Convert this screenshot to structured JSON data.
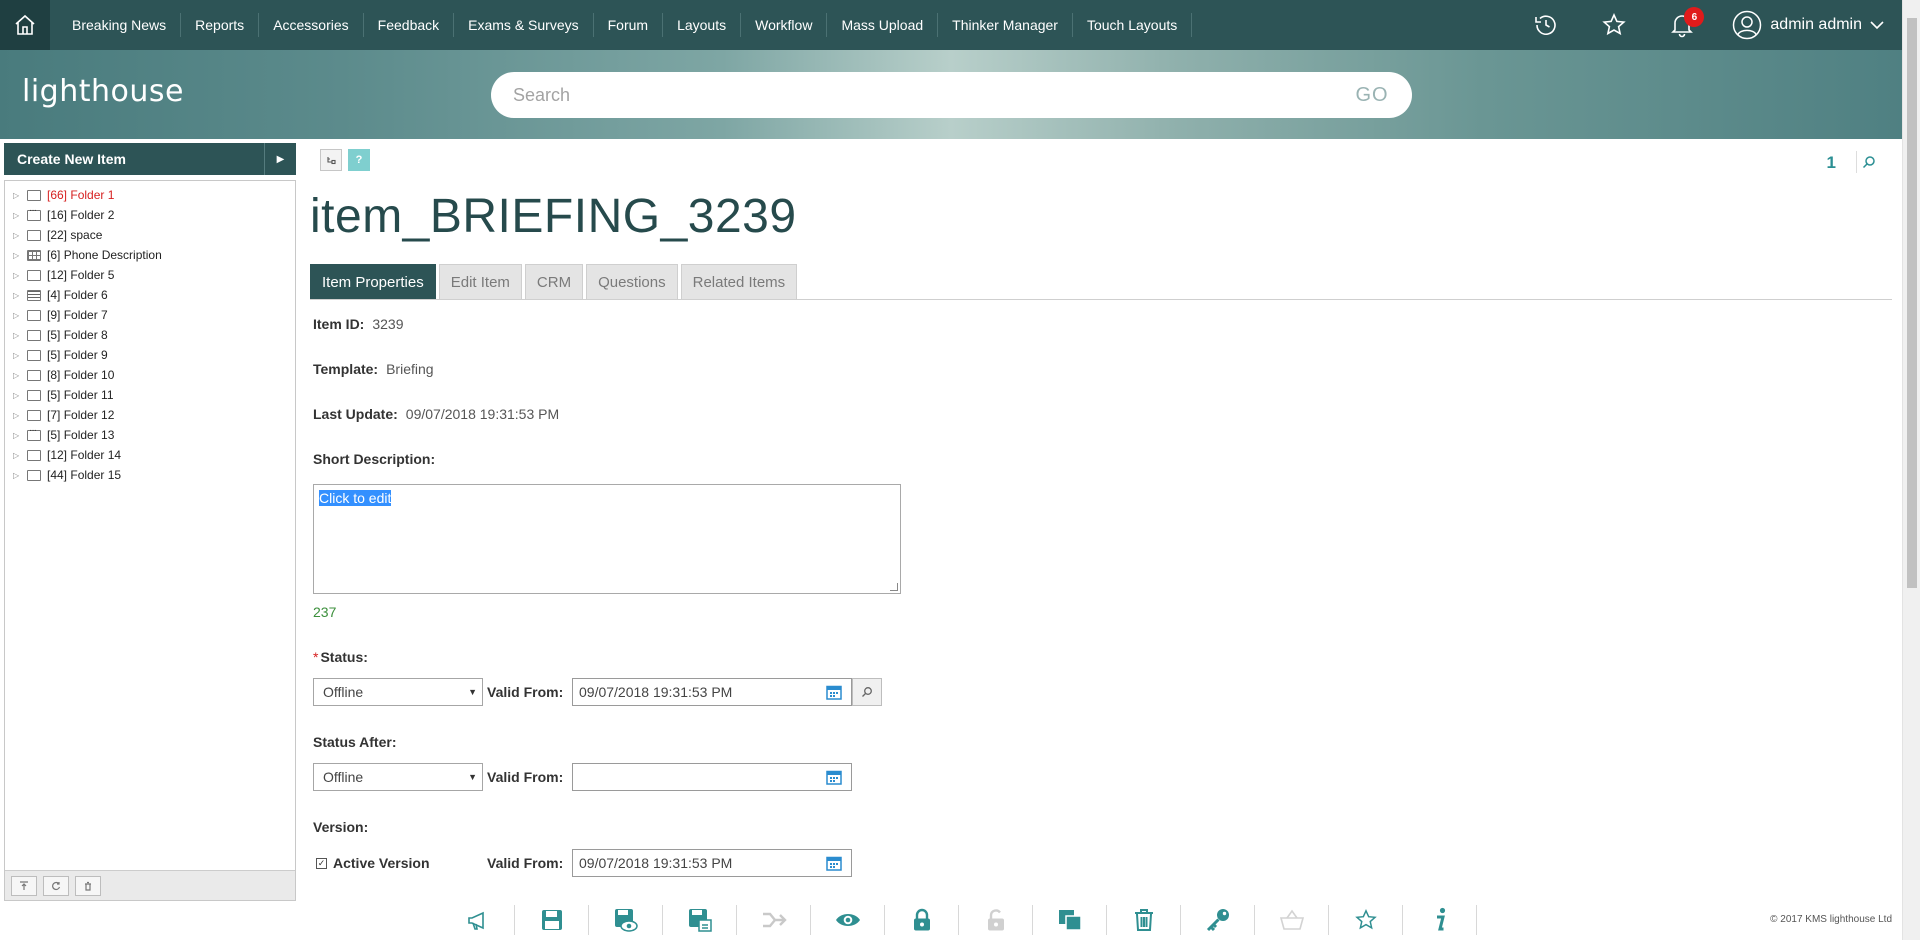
{
  "nav": {
    "items": [
      "Breaking News",
      "Reports",
      "Accessories",
      "Feedback",
      "Exams & Surveys",
      "Forum",
      "Layouts",
      "Workflow",
      "Mass Upload",
      "Thinker Manager",
      "Touch Layouts"
    ],
    "notifications_count": "6",
    "user_name": "admin admin"
  },
  "header": {
    "logo": "lighthouse",
    "search_placeholder": "Search",
    "go_label": "GO"
  },
  "sidebar": {
    "create_label": "Create New Item",
    "tree": [
      {
        "count": "[66]",
        "label": "Folder 1",
        "icon": "folder",
        "highlight": true
      },
      {
        "count": "[16]",
        "label": "Folder 2",
        "icon": "folder-dots"
      },
      {
        "count": "[22]",
        "label": "space",
        "icon": "folder"
      },
      {
        "count": "[6]",
        "label": "Phone Description",
        "icon": "folder-grid"
      },
      {
        "count": "[12]",
        "label": "Folder 5",
        "icon": "folder"
      },
      {
        "count": "[4]",
        "label": "Folder 6",
        "icon": "folder-bars"
      },
      {
        "count": "[9]",
        "label": "Folder 7",
        "icon": "folder"
      },
      {
        "count": "[5]",
        "label": "Folder 8",
        "icon": "folder"
      },
      {
        "count": "[5]",
        "label": "Folder 9",
        "icon": "folder"
      },
      {
        "count": "[8]",
        "label": "Folder 10",
        "icon": "folder"
      },
      {
        "count": "[5]",
        "label": "Folder 11",
        "icon": "folder"
      },
      {
        "count": "[7]",
        "label": "Folder 12",
        "icon": "folder"
      },
      {
        "count": "[5]",
        "label": "Folder 13",
        "icon": "folder-dots"
      },
      {
        "count": "[12]",
        "label": "Folder 14",
        "icon": "folder"
      },
      {
        "count": "[44]",
        "label": "Folder 15",
        "icon": "folder"
      }
    ]
  },
  "main": {
    "page_number": "1",
    "title": "item_BRIEFING_3239",
    "tabs": [
      "Item Properties",
      "Edit Item",
      "CRM",
      "Questions",
      "Related Items"
    ],
    "item_id_label": "Item ID:",
    "item_id": "3239",
    "template_label": "Template:",
    "template": "Briefing",
    "last_update_label": "Last Update:",
    "last_update": "09/07/2018 19:31:53 PM",
    "short_desc_label": "Short Description:",
    "short_desc_value": "Click to edit",
    "char_count": "237",
    "status_label": "Status:",
    "status_value": "Offline",
    "valid_from_label": "Valid From:",
    "status_valid_from": "09/07/2018 19:31:53 PM",
    "status_after_label": "Status After:",
    "status_after_value": "Offline",
    "status_after_valid_from": "",
    "version_label": "Version:",
    "active_version_label": "Active Version",
    "version_valid_from": "09/07/2018 19:31:53 PM"
  },
  "footer": {
    "copyright": "© 2017 KMS lighthouse Ltd"
  },
  "colors": {
    "nav_bg": "#2d5456",
    "accent": "#2b8f93",
    "icon_teal": "#2f8f91"
  }
}
